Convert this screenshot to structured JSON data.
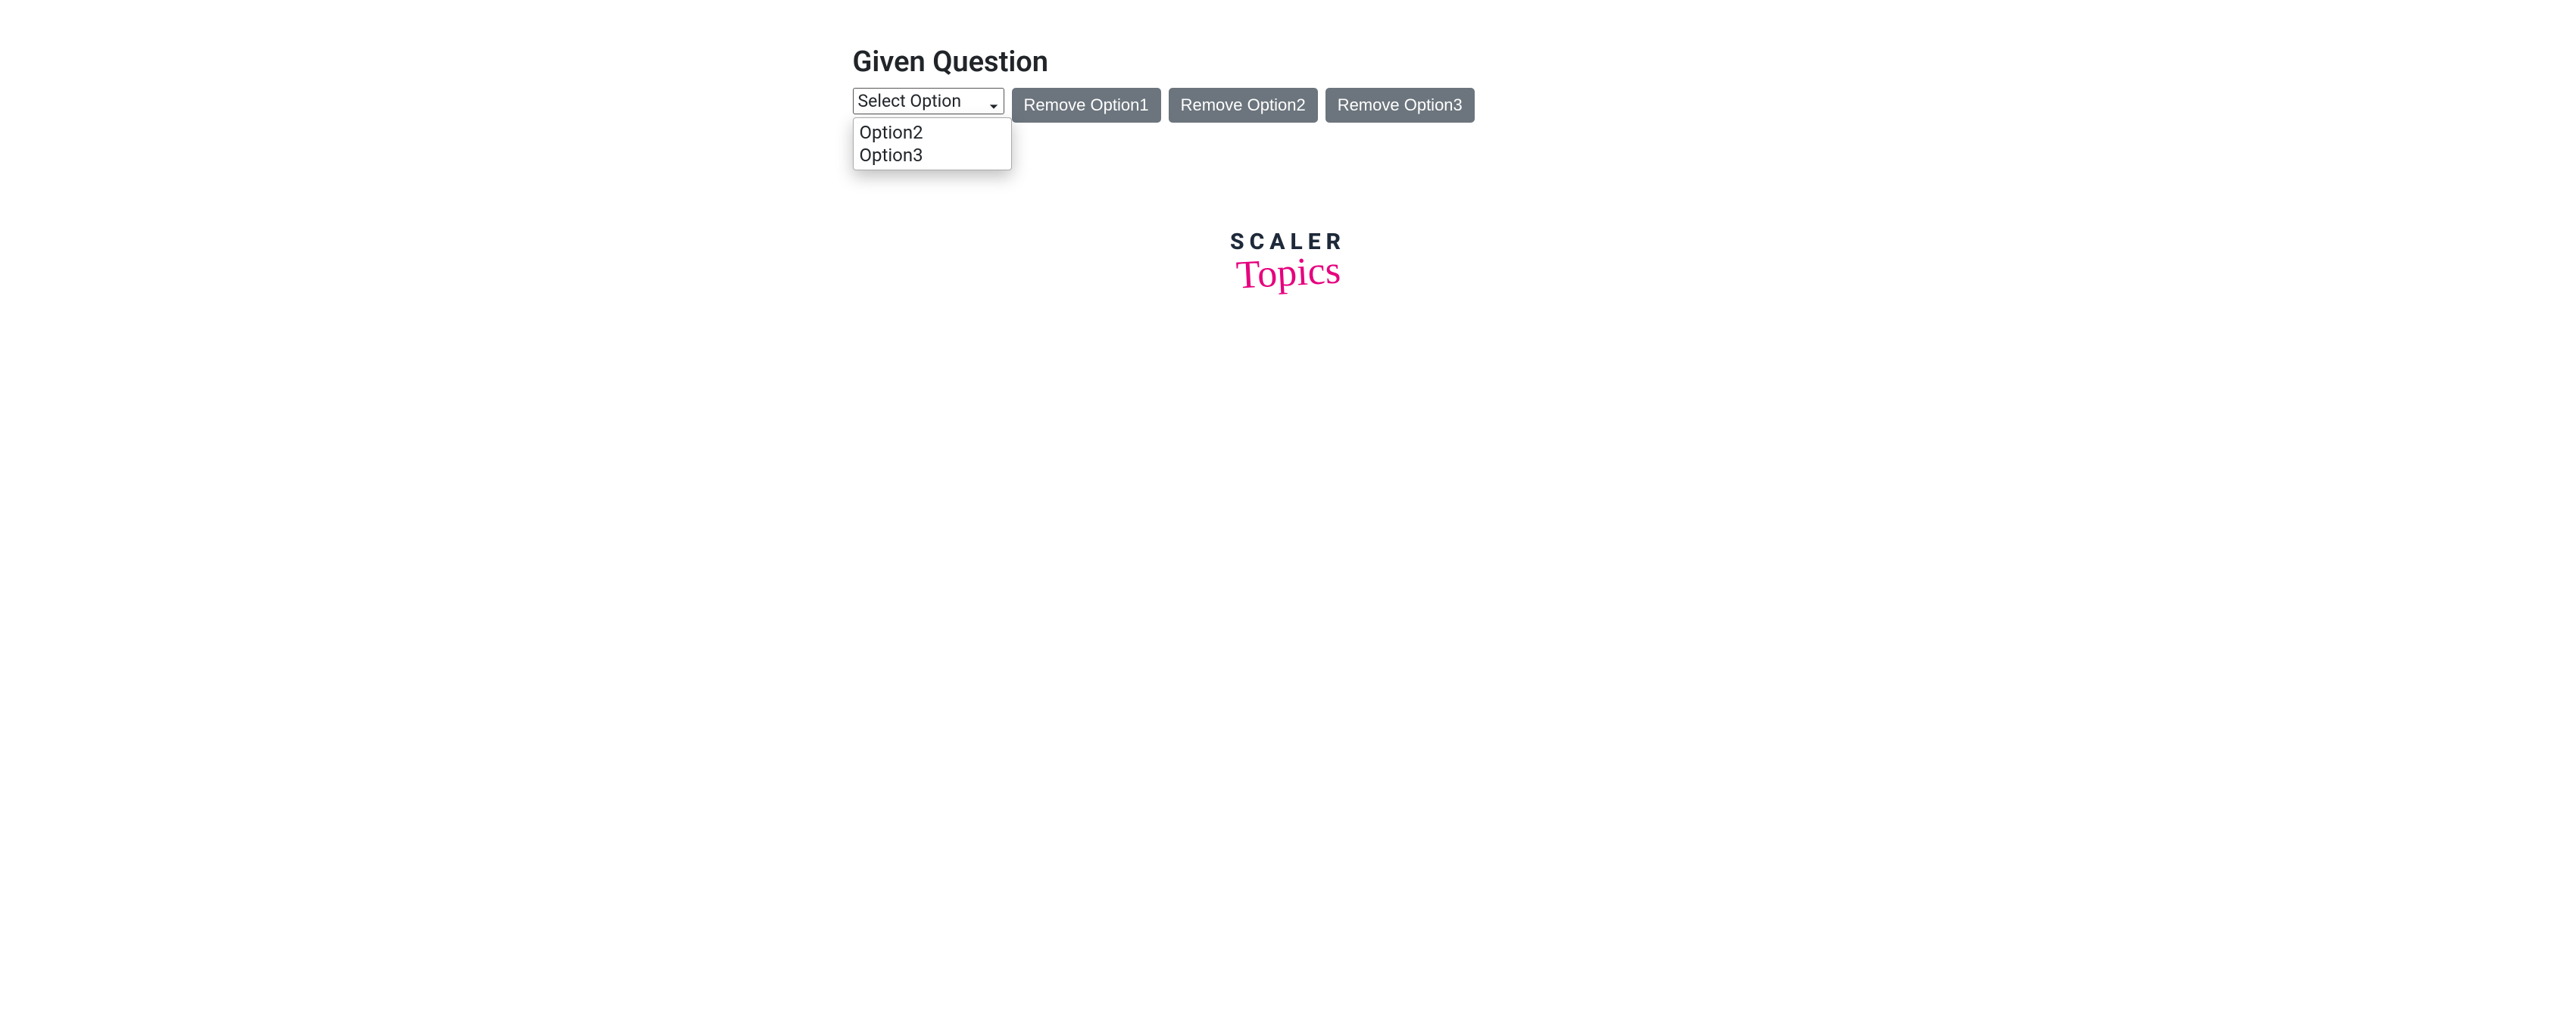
{
  "heading": "Given Question",
  "select": {
    "placeholder": "Select Option",
    "options": [
      "Option2",
      "Option3"
    ]
  },
  "buttons": {
    "remove1": "Remove Option1",
    "remove2": "Remove Option2",
    "remove3": "Remove Option3"
  },
  "branding": {
    "line1": "SCALER",
    "line2": "Topics"
  }
}
